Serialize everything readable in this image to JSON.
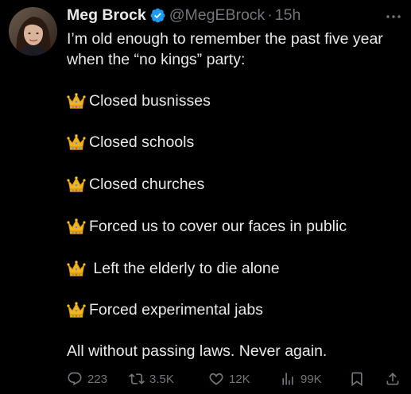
{
  "tweet": {
    "author": {
      "display_name": "Meg Brock",
      "handle": "@MegEBrock",
      "separator": "·",
      "time": "15h",
      "verified_icon": "verified-badge-icon"
    },
    "intro_lines": [
      "I’m old enough to remember the past five year",
      "when the “no kings” party:"
    ],
    "list_items": [
      "Closed busnisses",
      "Closed schools",
      "Closed churches",
      "Forced us to cover our faces in public",
      " Left the elderly to die alone",
      "Forced experimental jabs"
    ],
    "list_item_icon": "crown-emoji-icon",
    "closing": "All without passing laws. Never again.",
    "actions": {
      "replies": "223",
      "reposts": "3.5K",
      "likes": "12K",
      "views": "99K"
    }
  },
  "colors": {
    "background": "#000000",
    "text": "#e7e9ea",
    "muted": "#71767b",
    "verified": "#1d9bf0"
  }
}
